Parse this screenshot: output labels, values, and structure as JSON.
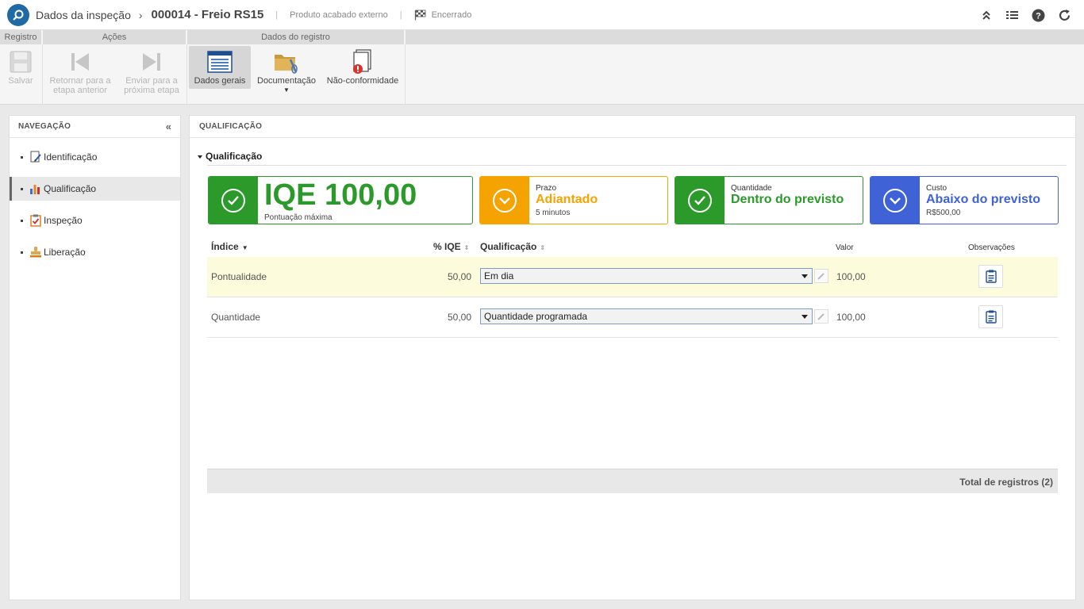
{
  "header": {
    "title": "Dados da inspeção",
    "separator": "›",
    "record": "000014 - Freio RS15",
    "pipe1": "|",
    "type": "Produto acabado externo",
    "pipe2": "|",
    "status": "Encerrado",
    "icons": [
      "double-chevron-up-icon",
      "list-icon",
      "help-icon",
      "refresh-icon"
    ]
  },
  "toolbar": {
    "groups": {
      "registro": "Registro",
      "acoes": "Ações",
      "dados": "Dados do registro"
    },
    "save": "Salvar",
    "return_l1": "Retornar para a",
    "return_l2": "etapa anterior",
    "send_l1": "Enviar para a",
    "send_l2": "próxima etapa",
    "general": "Dados gerais",
    "docs": "Documentação",
    "nonconf": "Não-conformidade"
  },
  "nav": {
    "title": "NAVEGAÇÃO",
    "items": [
      {
        "label": "Identificação",
        "icon": "edit-document-icon"
      },
      {
        "label": "Qualificação",
        "icon": "bar-chart-icon"
      },
      {
        "label": "Inspeção",
        "icon": "checklist-icon"
      },
      {
        "label": "Liberação",
        "icon": "stamp-icon"
      }
    ]
  },
  "main": {
    "title": "QUALIFICAÇÃO",
    "section": "Qualificação",
    "cards": {
      "iqe": {
        "value": "IQE 100,00",
        "sub": "Pontuação máxima",
        "color": "#2b9a2b"
      },
      "prazo": {
        "label": "Prazo",
        "value": "Adiantado",
        "sub": "5 minutos",
        "color": "#f5a300"
      },
      "quantidade": {
        "label": "Quantidade",
        "value": "Dentro do previsto",
        "color": "#2b9a2b"
      },
      "custo": {
        "label": "Custo",
        "value": "Abaixo do previsto",
        "sub": "R$500,00",
        "color": "#3f62d6"
      }
    },
    "grid": {
      "columns": {
        "indice": "Índice",
        "iqe": "% IQE",
        "qualificacao": "Qualificação",
        "valor": "Valor",
        "observacoes": "Observações"
      },
      "rows": [
        {
          "indice": "Pontualidade",
          "iqe": "50,00",
          "qualificacao": "Em dia",
          "valor": "100,00"
        },
        {
          "indice": "Quantidade",
          "iqe": "50,00",
          "qualificacao": "Quantidade programada",
          "valor": "100,00"
        }
      ],
      "total": "Total de registros (2)"
    }
  }
}
